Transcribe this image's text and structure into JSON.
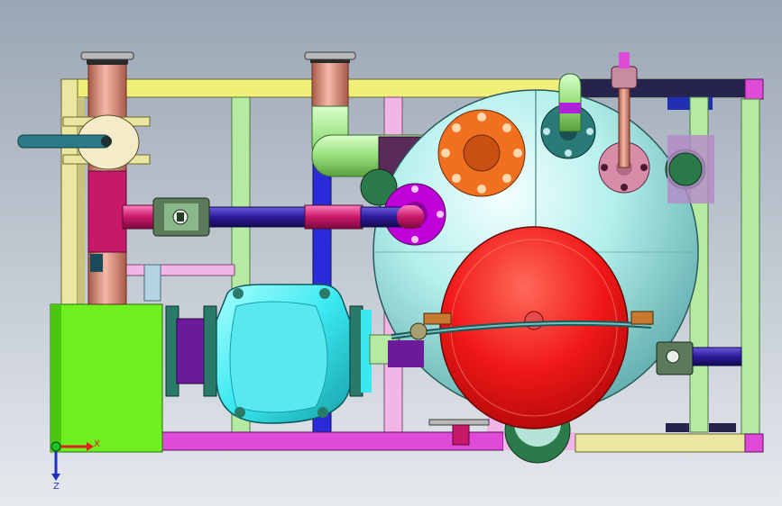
{
  "viewport": {
    "background_top": "#9aa6b4",
    "background_bottom": "#e6e9ee"
  },
  "triad": {
    "x_label": "X",
    "z_label": "Z",
    "x_color": "#e02020",
    "z_color": "#2030c0",
    "origin_color": "#20c020"
  },
  "parts": {
    "frame_yellow": "#f2ee7a",
    "frame_pale": "#ece7a0",
    "frame_light_green": "#b6eaa2",
    "frame_pink": "#f2b6e6",
    "frame_blue": "#2a2ad8",
    "frame_navy": "#24244e",
    "frame_magenta": "#e04ad8",
    "base_green": "#6ef020",
    "tank_cyan": "#9fe8e4",
    "tank_red": "#f01818",
    "flange_orange": "#f07020",
    "flange_teal": "#2a7a78",
    "flange_mauve": "#d88ca8",
    "flange_violet": "#c000d8",
    "pipe_copper": "#d8907e",
    "pipe_magenta": "#c8186a",
    "pipe_green": "#98e07c",
    "pipe_indigo": "#2c1a9a",
    "pump_cyan": "#3ae8f0",
    "pump_purple": "#6a1a9a",
    "lever_teal": "#2a7a8a",
    "knob_cream": "#f4ecc8"
  }
}
